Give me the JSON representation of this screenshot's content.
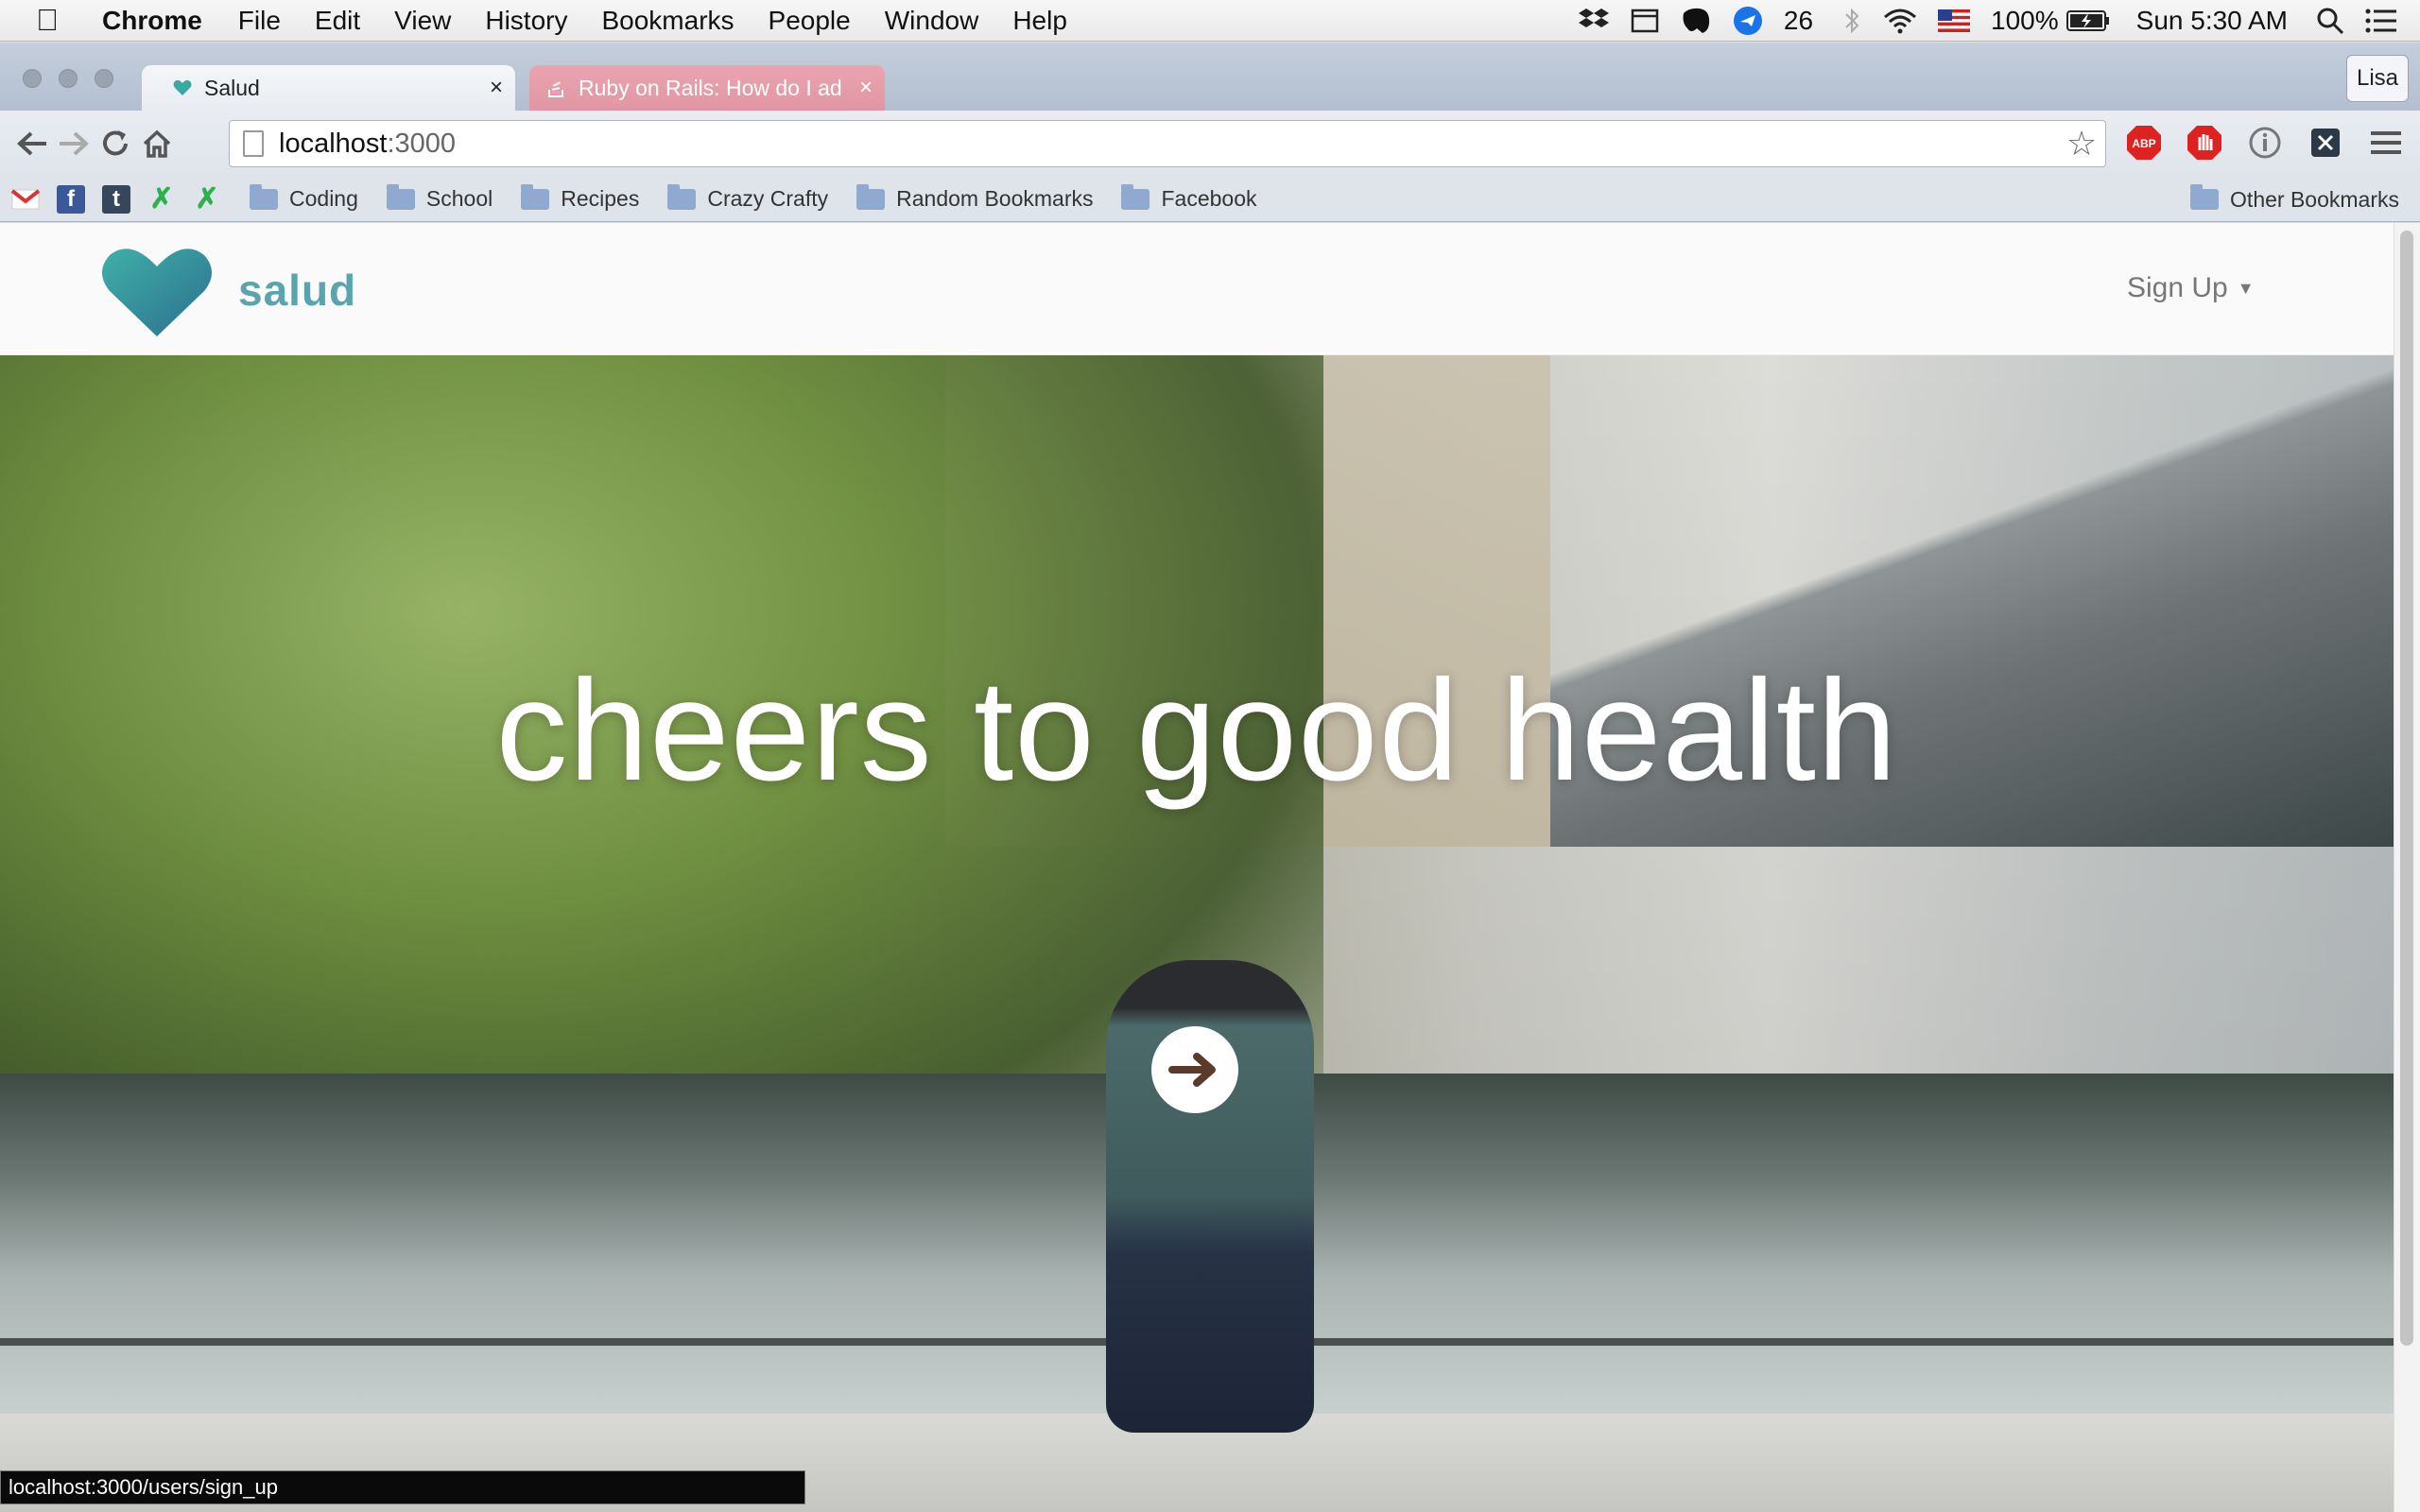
{
  "menubar": {
    "app": "Chrome",
    "items": [
      "File",
      "Edit",
      "View",
      "History",
      "Bookmarks",
      "People",
      "Window",
      "Help"
    ],
    "status_count": "26",
    "battery": "100%",
    "clock": "Sun 5:30 AM"
  },
  "tabs": [
    {
      "title": "Salud",
      "favicon": "heart-icon",
      "active": true
    },
    {
      "title": "Ruby on Rails: How do I ad",
      "favicon": "stackoverflow-icon",
      "active": false
    }
  ],
  "profile": "Lisa",
  "address_bar": {
    "host": "localhost",
    "port": ":3000"
  },
  "bookmarks": {
    "folders": [
      "Coding",
      "School",
      "Recipes",
      "Crazy Crafty",
      "Random Bookmarks",
      "Facebook"
    ],
    "other": "Other Bookmarks"
  },
  "site": {
    "brand": "salud",
    "signup": "Sign Up",
    "hero_title": "cheers to good health"
  },
  "status_url": "localhost:3000/users/sign_up",
  "colors": {
    "brand": "#5aa5ad",
    "heart_start": "#3aa7a3",
    "heart_end": "#2f7f95"
  }
}
